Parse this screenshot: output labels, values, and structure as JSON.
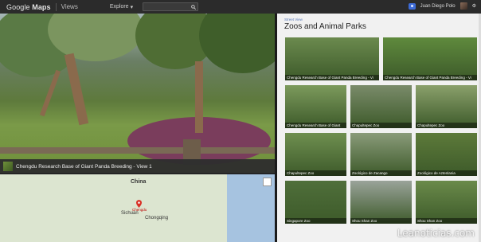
{
  "topbar": {
    "brand_google": "Google",
    "brand_maps": "Maps",
    "section": "Views",
    "explore": "Explore",
    "user_name": "Juan Diego Polo"
  },
  "pano": {
    "caption": "Chengdu Research Base of Giant Panda Breeding - View 1"
  },
  "map": {
    "country": "China",
    "cities": [
      "Sichuan",
      "Chongqing",
      "Chengdu"
    ]
  },
  "panel": {
    "breadcrumb": "Street View",
    "title": "Zoos and Animal Parks",
    "tiles": [
      {
        "label": "Chengdu Research Base of Giant Panda Breeding - Vi",
        "color": "#6b8a4e"
      },
      {
        "label": "Chengdu Research Base of Giant Panda Breeding - Vi",
        "color": "#5f8a3d"
      },
      {
        "label": "Chengdu Research Base of Giant",
        "color": "#7c9a5c"
      },
      {
        "label": "Chapultepec Zoo",
        "color": "#7a8b6a"
      },
      {
        "label": "Chapultepec Zoo",
        "color": "#8aa06b"
      },
      {
        "label": "Chapultepec Zoo",
        "color": "#6f8f50"
      },
      {
        "label": "Zoológico de Zacango",
        "color": "#8a9b7a"
      },
      {
        "label": "Zoológico de Aztenlania",
        "color": "#5d7a3a"
      },
      {
        "label": "Singapore Zoo",
        "color": "#4f6f3a"
      },
      {
        "label": "Shou Shan Zoo",
        "color": "#9aa39a"
      },
      {
        "label": "Shou Shan Zoo",
        "color": "#6a8a4a"
      }
    ]
  },
  "watermark": "Leanoticias.com"
}
